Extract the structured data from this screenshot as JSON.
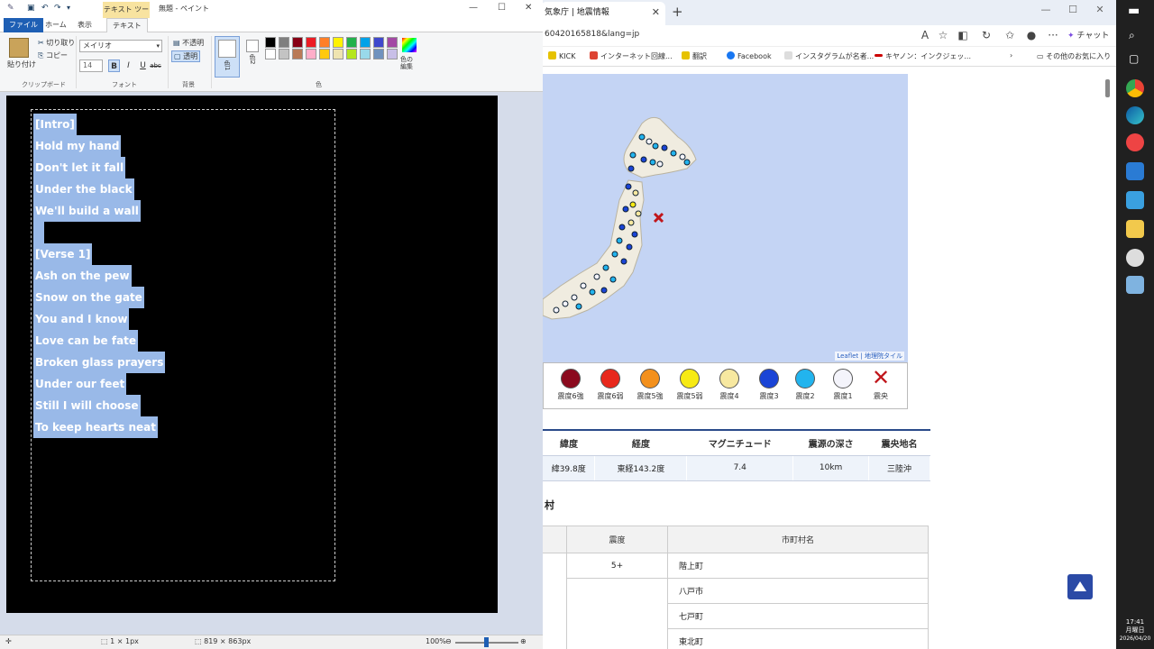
{
  "browser": {
    "tab_title": "気象庁 | 地震情報",
    "url": "60420165818&lang=jp",
    "copilot_label": "チャット",
    "bookmarks": [
      "KICK",
      "インターネット回線...",
      "翻訳",
      "Facebook",
      "インスタグラムが名者...",
      "キヤノン：インクジェッ..."
    ],
    "other_bookmarks": "その他のお気に入り",
    "map_attribution": "Leaflet | 地理院タイル",
    "legend": [
      {
        "label": "震度6強",
        "color": "#8b0a1e"
      },
      {
        "label": "震度6弱",
        "color": "#e8281c"
      },
      {
        "label": "震度5強",
        "color": "#f3901c"
      },
      {
        "label": "震度5弱",
        "color": "#f7ea14"
      },
      {
        "label": "震度4",
        "color": "#f7e8a0"
      },
      {
        "label": "震度3",
        "color": "#1a44d6"
      },
      {
        "label": "震度2",
        "color": "#22b4ee"
      },
      {
        "label": "震度1",
        "color": "#f4f4fb"
      },
      {
        "label": "震央",
        "color": "#c0161b"
      }
    ],
    "eq_headers": [
      "緯度",
      "経度",
      "マグニチュード",
      "震源の深さ",
      "震央地名"
    ],
    "eq_row": [
      "緯39.8度",
      "東経143.2度",
      "7.4",
      "10km",
      "三陸沖"
    ],
    "section_title": "村",
    "city_headers": [
      "震度",
      "市町村名"
    ],
    "city_rows": [
      {
        "intensity": "5+",
        "city": "階上町"
      },
      {
        "intensity": "",
        "city": "八戸市"
      },
      {
        "intensity": "",
        "city": "七戸町"
      },
      {
        "intensity": "",
        "city": "東北町"
      }
    ]
  },
  "paint": {
    "context_tab": "テキスト ツール",
    "window_title": "無題 - ペイント",
    "tabs": [
      "ファイル",
      "ホーム",
      "表示",
      "テキスト"
    ],
    "clipboard": {
      "paste": "貼り付け",
      "cut": "切り取り",
      "copy": "コピー",
      "group": "クリップボード"
    },
    "font": {
      "family": "メイリオ",
      "size": "14",
      "group": "フォント",
      "bold": "B",
      "italic": "I",
      "underline": "U",
      "strike": "abc"
    },
    "background": {
      "opaque": "不透明",
      "transparent": "透明",
      "group": "背景"
    },
    "colors": {
      "color1": "色1",
      "color2": "色2",
      "edit": "色の編集",
      "group": "色"
    },
    "palette": [
      "#000000",
      "#7f7f7f",
      "#880015",
      "#ed1c24",
      "#ff7f27",
      "#fff200",
      "#22b14c",
      "#00a2e8",
      "#3f48cc",
      "#a349a4",
      "#ffffff",
      "#c3c3c3",
      "#b97a57",
      "#ffaec9",
      "#ffc90e",
      "#efe4b0",
      "#b5e61d",
      "#99d9ea",
      "#7092be",
      "#c8bfe7"
    ],
    "lyrics": [
      "[Intro]",
      "Hold my hand",
      "Don't let it fall",
      "Under the black",
      "We'll build a wall",
      "",
      "[Verse 1]",
      "Ash on the pew",
      "Snow on the gate",
      "You and I know",
      "Love can be fate",
      "Broken glass prayers",
      "Under our feet",
      "Still I will choose",
      "To keep hearts neat"
    ],
    "status": {
      "selection": "1 × 1px",
      "size": "819 × 863px",
      "zoom": "100%"
    }
  },
  "taskbar": {
    "time": "17:41",
    "day": "月曜日",
    "date": "2026/04/20"
  }
}
